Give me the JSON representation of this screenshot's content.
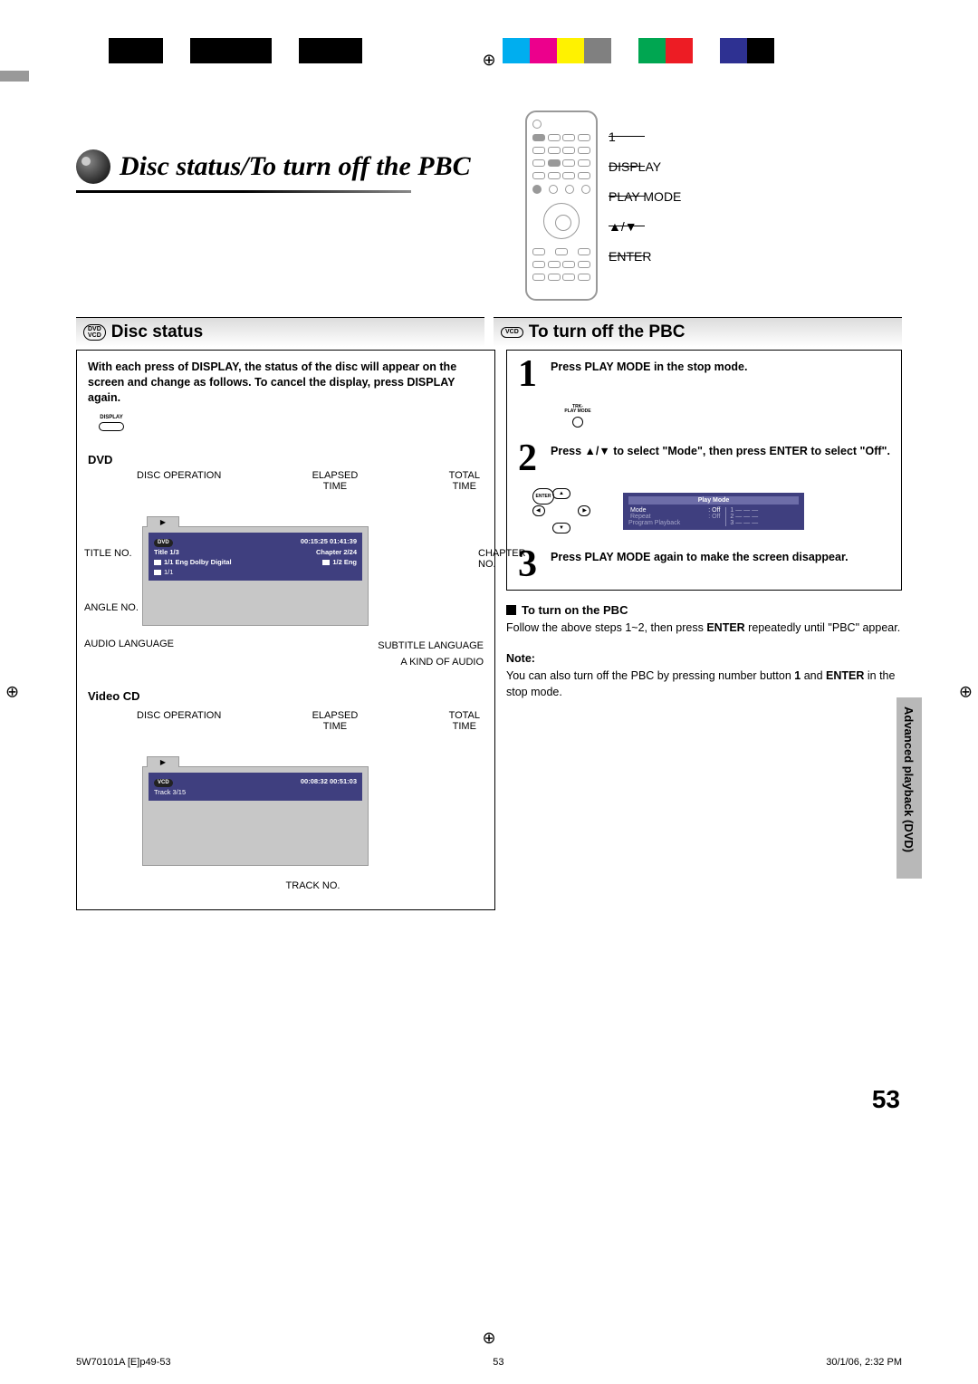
{
  "registration": {
    "mark": "⊕"
  },
  "color_bar": [
    "#00aeef",
    "#ec008c",
    "#fff200",
    "#808080",
    "#ffffff",
    "#00a651",
    "#ed1c24",
    "#ffffff",
    "#2e3192",
    "#000000"
  ],
  "header": {
    "title": "Disc status/To turn off the PBC"
  },
  "remote_labels": {
    "one": "1",
    "display": "DISPLAY",
    "playmode": "PLAY MODE",
    "arrows": "▲/▼",
    "enter": "ENTER"
  },
  "sections": {
    "left_badge_top": "DVD",
    "left_badge_bottom": "VCD",
    "left_title": "Disc status",
    "right_badge": "VCD",
    "right_title": "To turn off the PBC"
  },
  "left": {
    "intro": "With each press of DISPLAY, the status of the disc will appear on the screen and change as follows. To cancel the display, press DISPLAY again.",
    "display_label": "DISPLAY",
    "dvd_head": "DVD",
    "callouts": {
      "disc_operation": "DISC OPERATION",
      "elapsed_time": "ELAPSED\nTIME",
      "total_time": "TOTAL\nTIME",
      "title_no": "TITLE NO.",
      "chapter_no": "CHAPTER\nNO.",
      "angle_no": "ANGLE NO.",
      "subtitle_lang": "SUBTITLE LANGUAGE",
      "audio_lang": "AUDIO LANGUAGE",
      "audio_kind": "A KIND OF AUDIO",
      "track_no": "TRACK NO."
    },
    "osd_dvd": {
      "badge": "DVD",
      "times": "00:15:25  01:41:39",
      "title": "Title  1/3",
      "chapter": "Chapter 2/24",
      "audio": "1/1 Eng Dolby Digital",
      "sub": "1/2 Eng",
      "angle": "1/1"
    },
    "vcd_head": "Video CD",
    "osd_vcd": {
      "badge": "VCD",
      "times": "00:08:32  00:51:03",
      "track": "Track  3/15"
    }
  },
  "right": {
    "step1": "Press PLAY MODE in the stop mode.",
    "mini_btn_top": "TRK-",
    "mini_btn_bottom": "PLAY MODE",
    "step2": "Press ▲/▼ to select \"Mode\", then press ENTER to select \"Off\".",
    "dpad_center": "ENTER",
    "playmode_osd": {
      "title": "Play Mode",
      "mode_label": "Mode",
      "mode_value": ": Off",
      "repeat_label": "Repeat",
      "repeat_value": ": Off",
      "program_label": "Program Playback",
      "slot1": "1  — — —",
      "slot2": "2  — — —",
      "slot3": "3  — — —"
    },
    "step3": "Press PLAY MODE again to make the screen disappear.",
    "turn_on_head": "To turn on the PBC",
    "turn_on_body_a": "Follow the above steps 1~2, then press ",
    "turn_on_body_b": "ENTER",
    "turn_on_body_c": " repeatedly until \"PBC\" appear.",
    "note_head": "Note:",
    "note_body_a": "You can also turn off the PBC by pressing number button ",
    "note_body_b": "1",
    "note_body_c": " and ",
    "note_body_d": "ENTER",
    "note_body_e": " in the stop mode."
  },
  "side_tab": "Advanced playback (DVD)",
  "page_number": "53",
  "footer": {
    "left": "5W70101A [E]p49-53",
    "center": "53",
    "right": "30/1/06, 2:32 PM"
  }
}
